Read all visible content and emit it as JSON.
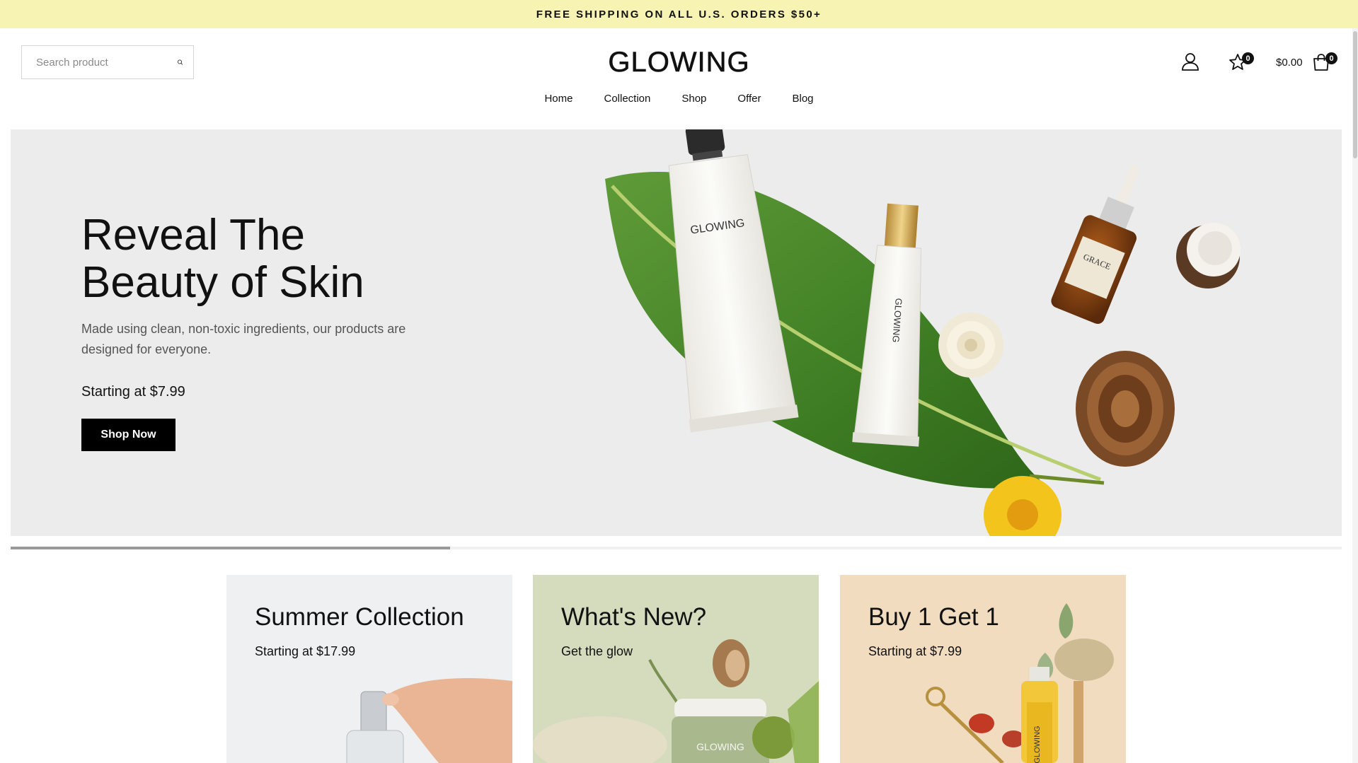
{
  "announcement": "FREE SHIPPING ON ALL U.S. ORDERS $50+",
  "search": {
    "placeholder": "Search product"
  },
  "logo": "GLOWING",
  "nav": [
    "Home",
    "Collection",
    "Shop",
    "Offer",
    "Blog"
  ],
  "header": {
    "wishlist_count": "0",
    "cart_total": "$0.00",
    "cart_count": "0"
  },
  "hero": {
    "title_line1": "Reveal The",
    "title_line2": "Beauty of Skin",
    "subtitle": "Made using clean, non-toxic ingredients, our products are designed for everyone.",
    "price": "Starting at $7.99",
    "button": "Shop Now",
    "product_labels": {
      "tube_large": "GLOWING",
      "tube_small": "GLOWING",
      "bottle": "GRACE"
    },
    "slider_progress": 0.33
  },
  "cards": [
    {
      "title": "Summer Collection",
      "subtitle": "Starting at $17.99",
      "bg": "#eef0f2"
    },
    {
      "title": "What's New?",
      "subtitle": "Get the glow",
      "bg": "#d4dcbd",
      "jar_label": "GLOWING"
    },
    {
      "title": "Buy 1 Get 1",
      "subtitle": "Starting at $7.99",
      "bg": "#f1dcc0",
      "bottle_label": "GLOWING"
    }
  ],
  "colors": {
    "announcement_bg": "#f6f3b3",
    "hero_bg": "#ececec",
    "button_bg": "#000000",
    "leaf": "#4a8a2c"
  },
  "icons": [
    "search-icon",
    "user-icon",
    "wishlist-star-icon",
    "cart-bag-icon"
  ]
}
